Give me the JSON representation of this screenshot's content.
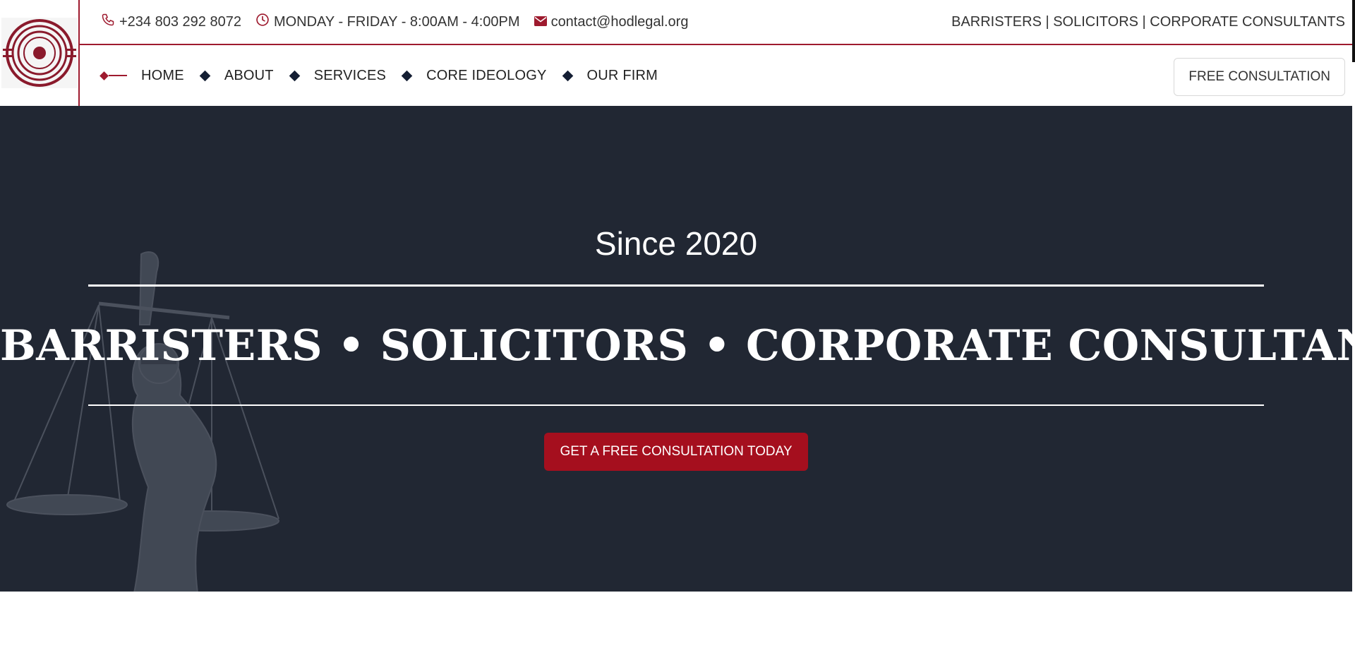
{
  "topbar": {
    "phone": "+234 803 292 8072",
    "hours": "MONDAY - FRIDAY - 8:00AM - 4:00PM",
    "email": "contact@hodlegal.org",
    "tagline": "BARRISTERS | SOLICITORS | CORPORATE CONSULTANTS"
  },
  "nav": {
    "items": [
      {
        "label": "HOME"
      },
      {
        "label": "ABOUT"
      },
      {
        "label": "SERVICES"
      },
      {
        "label": "CORE IDEOLOGY"
      },
      {
        "label": "OUR FIRM"
      }
    ],
    "cta_label": "FREE CONSULTATION"
  },
  "hero": {
    "since": "Since 2020",
    "headline": "BARRISTERS • SOLICITORS • CORPORATE CONSULTANTS",
    "button_label": "GET A FREE CONSULTATION TODAY"
  },
  "colors": {
    "accent": "#9e1a2e",
    "hero_bg": "#212733",
    "button": "#a50f1e",
    "nav_diamond": "#141e33"
  },
  "icons": [
    "logo-icon",
    "phone-icon",
    "clock-icon",
    "mail-icon",
    "diamond-icon"
  ]
}
